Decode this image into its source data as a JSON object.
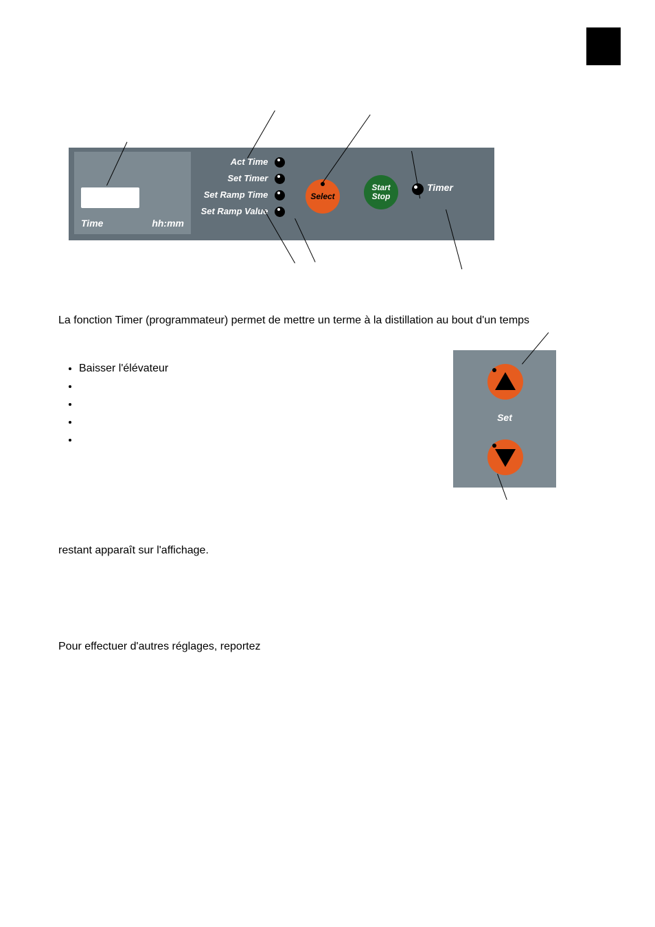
{
  "panel": {
    "time_label": "Time",
    "hhmm_label": "hh:mm",
    "leds": {
      "act_time": "Act Time",
      "set_timer": "Set Timer",
      "set_ramp_time": "Set Ramp Time",
      "set_ramp_value": "Set Ramp Value"
    },
    "select_btn": "Select",
    "startstop_btn": "Start\nStop",
    "timer_label": "Timer"
  },
  "set_panel": {
    "label": "Set"
  },
  "text": {
    "para1": "La fonction Timer (programmateur) permet de mettre un terme à la distillation au bout d'un temps",
    "bullet1": "Baisser l'élévateur",
    "para2": "restant apparaît sur l'affichage.",
    "para3": "Pour effectuer d'autres réglages, reportez"
  }
}
